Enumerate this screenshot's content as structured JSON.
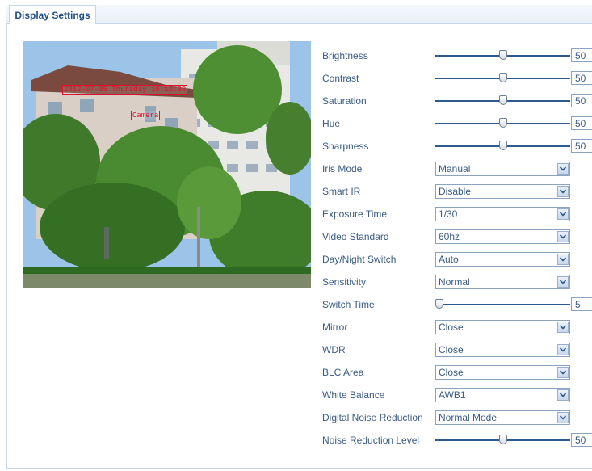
{
  "tabs": [
    {
      "label": "Display Settings",
      "active": true
    }
  ],
  "preview": {
    "osd_datetime": "2012-07-05 Thursday 10:12:38",
    "osd_camera_name": "Camera"
  },
  "settings": [
    {
      "key": "brightness",
      "label": "Brightness",
      "type": "slider",
      "value": "50",
      "fraction": 0.5
    },
    {
      "key": "contrast",
      "label": "Contrast",
      "type": "slider",
      "value": "50",
      "fraction": 0.5
    },
    {
      "key": "saturation",
      "label": "Saturation",
      "type": "slider",
      "value": "50",
      "fraction": 0.5
    },
    {
      "key": "hue",
      "label": "Hue",
      "type": "slider",
      "value": "50",
      "fraction": 0.5
    },
    {
      "key": "sharpness",
      "label": "Sharpness",
      "type": "slider",
      "value": "50",
      "fraction": 0.5
    },
    {
      "key": "iris-mode",
      "label": "Iris Mode",
      "type": "select",
      "value": "Manual"
    },
    {
      "key": "smart-ir",
      "label": "Smart IR",
      "type": "select",
      "value": "Disable"
    },
    {
      "key": "exposure-time",
      "label": "Exposure Time",
      "type": "select",
      "value": "1/30"
    },
    {
      "key": "video-standard",
      "label": "Video Standard",
      "type": "select",
      "value": "60hz"
    },
    {
      "key": "day-night-switch",
      "label": "Day/Night Switch",
      "type": "select",
      "value": "Auto"
    },
    {
      "key": "sensitivity",
      "label": "Sensitivity",
      "type": "select",
      "value": "Normal"
    },
    {
      "key": "switch-time",
      "label": "Switch Time",
      "type": "slider",
      "value": "5",
      "fraction": 0.0
    },
    {
      "key": "mirror",
      "label": "Mirror",
      "type": "select",
      "value": "Close"
    },
    {
      "key": "wdr",
      "label": "WDR",
      "type": "select",
      "value": "Close"
    },
    {
      "key": "blc-area",
      "label": "BLC Area",
      "type": "select",
      "value": "Close"
    },
    {
      "key": "white-balance",
      "label": "White Balance",
      "type": "select",
      "value": "AWB1"
    },
    {
      "key": "digital-noise-reduction",
      "label": "Digital Noise Reduction",
      "type": "select",
      "value": "Normal Mode"
    },
    {
      "key": "noise-reduction-level",
      "label": "Noise Reduction Level",
      "type": "slider",
      "value": "50",
      "fraction": 0.5
    }
  ],
  "colors": {
    "accent": "#2e5a8e",
    "label": "#3a5b86",
    "osd": "#e0102a"
  }
}
